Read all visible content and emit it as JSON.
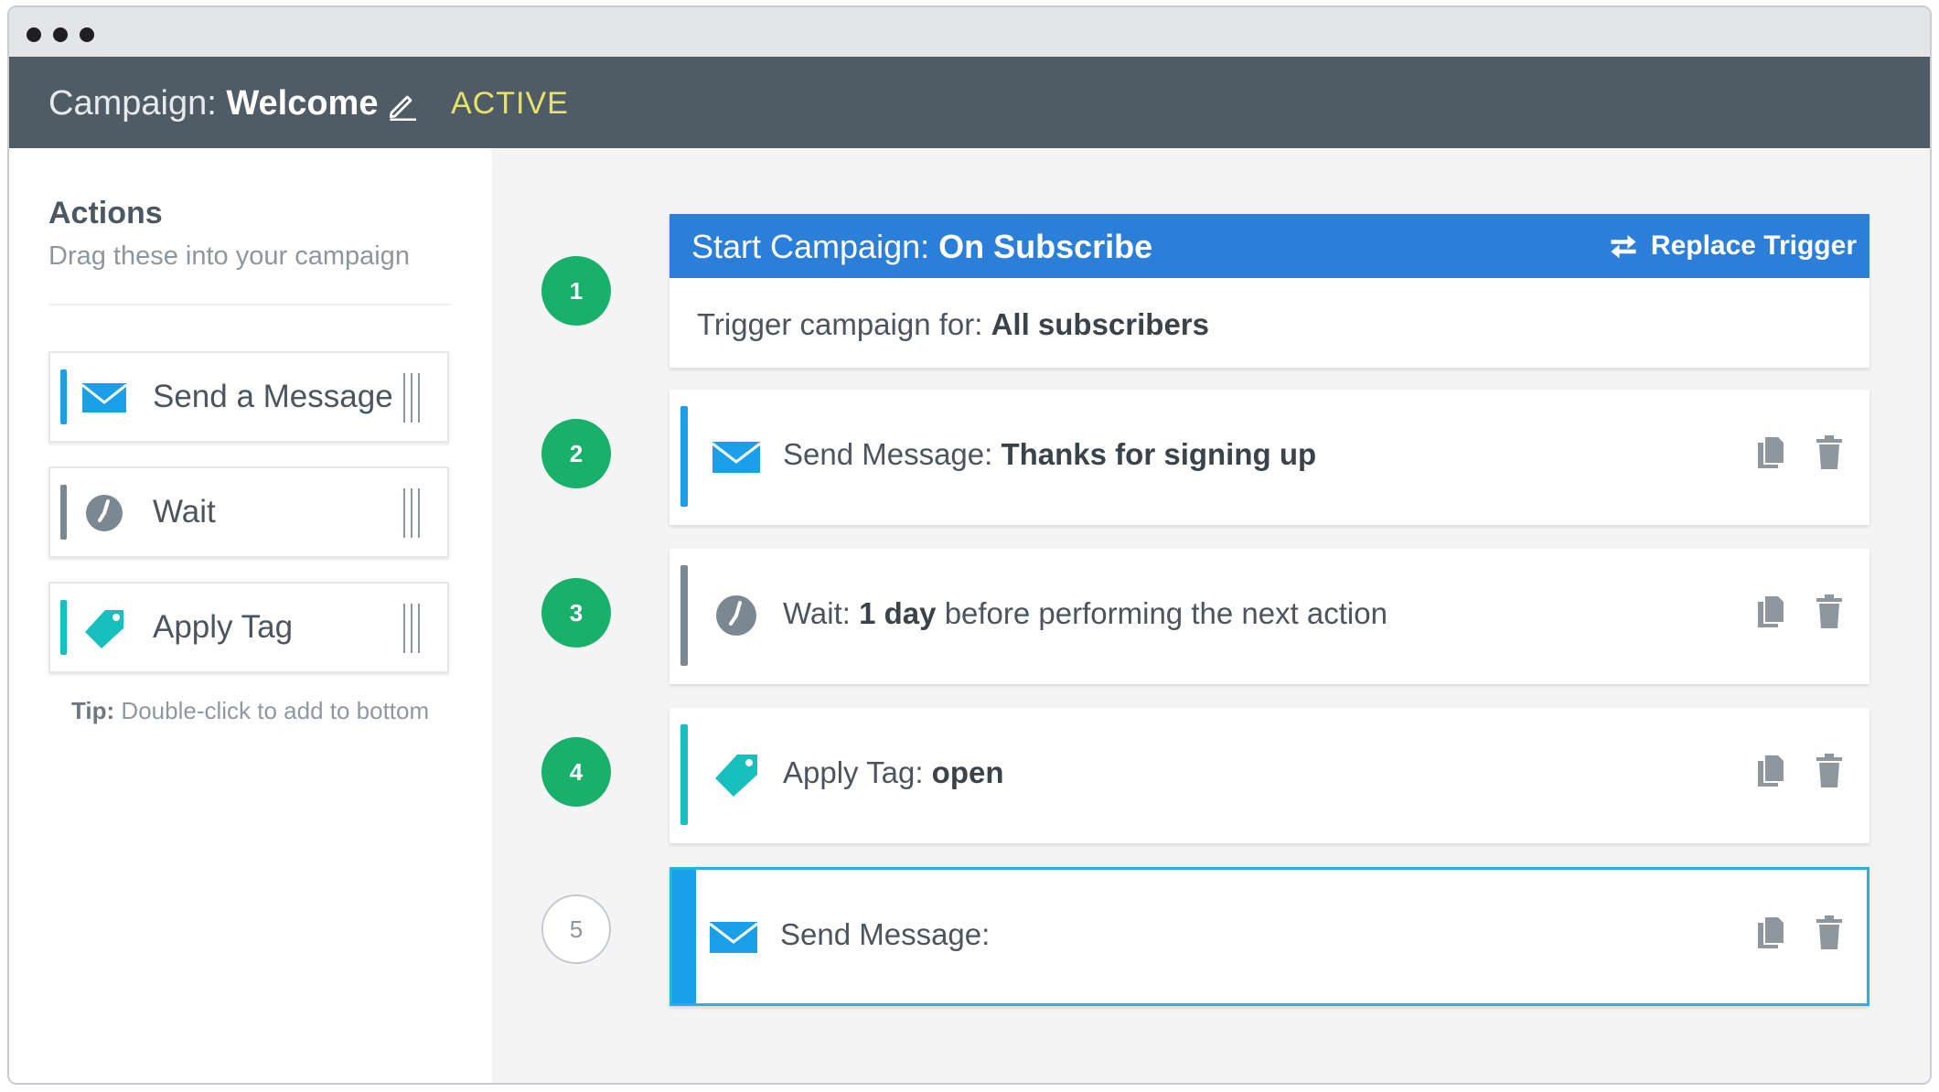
{
  "window": {
    "controls": [
      "close",
      "minimize",
      "maximize"
    ]
  },
  "header": {
    "title_prefix": "Campaign:",
    "campaign_name": "Welcome",
    "status": "ACTIVE",
    "edit_icon": "pencil-icon"
  },
  "sidebar": {
    "title": "Actions",
    "subtitle": "Drag these into your campaign",
    "items": [
      {
        "label": "Send a Message",
        "icon": "envelope-icon",
        "color": "#1aa0e8"
      },
      {
        "label": "Wait",
        "icon": "clock-icon",
        "color": "#7b8891"
      },
      {
        "label": "Apply Tag",
        "icon": "tag-icon",
        "color": "#17bfbf"
      }
    ],
    "tip_label": "Tip:",
    "tip_text": "Double-click to add to bottom"
  },
  "trigger": {
    "step": "1",
    "title_prefix": "Start Campaign:",
    "title_value": "On Subscribe",
    "replace_label": "Replace Trigger",
    "body_prefix": "Trigger campaign for:",
    "body_value": "All subscribers",
    "color": "#2c7fd9"
  },
  "steps": [
    {
      "num": "2",
      "icon": "envelope-icon",
      "color": "#1aa0e8",
      "label": "Send Message:",
      "value": "Thanks for signing up",
      "suffix": ""
    },
    {
      "num": "3",
      "icon": "clock-icon",
      "color": "#7b8891",
      "label": "Wait:",
      "value": "1 day",
      "suffix": "before performing the next action"
    },
    {
      "num": "4",
      "icon": "tag-icon",
      "color": "#17bfbf",
      "label": "Apply Tag:",
      "value": "open",
      "suffix": ""
    },
    {
      "num": "5",
      "icon": "envelope-icon",
      "color": "#1aa0e8",
      "label": "Send Message:",
      "value": "",
      "suffix": "",
      "selected": true
    }
  ],
  "colors": {
    "header_bg": "#4f5c66",
    "status": "#e5e36a",
    "step_done": "#18b06a",
    "selected_border": "#29b1e4"
  }
}
